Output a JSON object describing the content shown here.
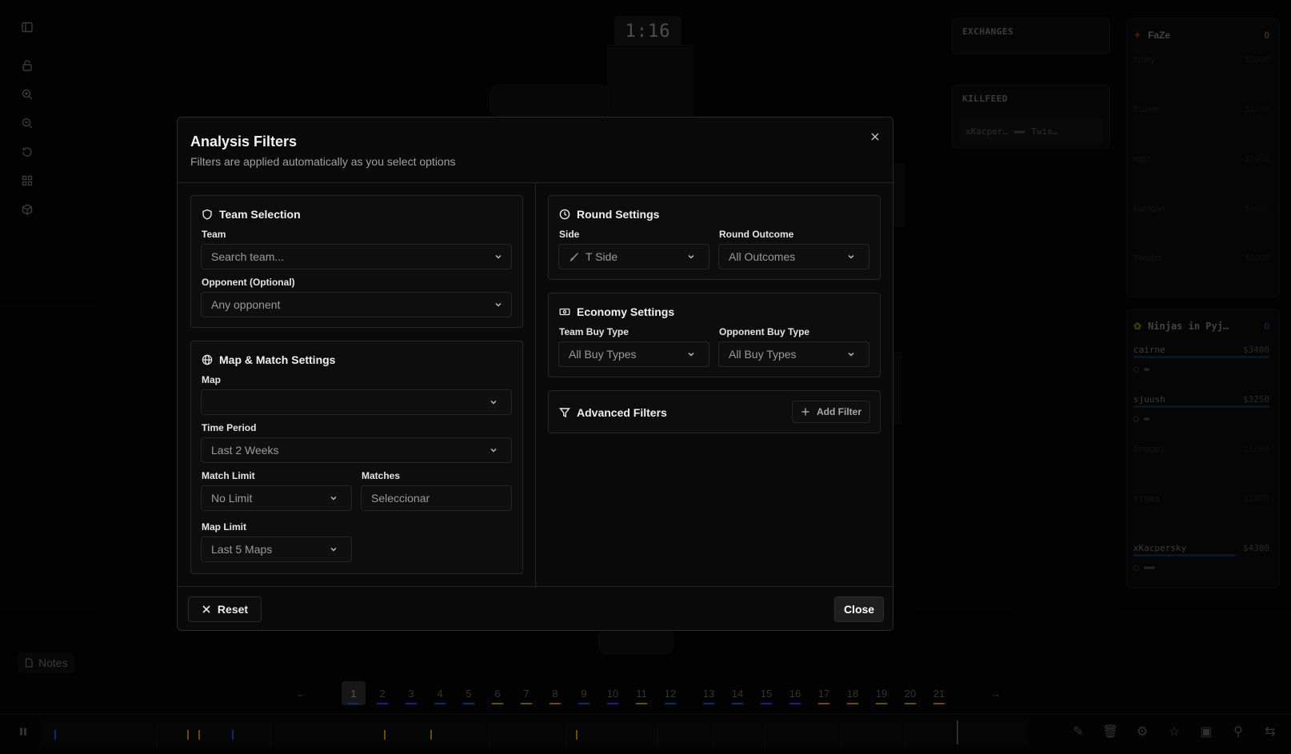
{
  "background": {
    "timer": "1:16",
    "exchanges_title": "EXCHANGES",
    "killfeed_title": "KILLFEED",
    "killfeed_entry": {
      "attacker": "xKacper…",
      "victim": "Twis…"
    },
    "team_a": {
      "name": "FaZe",
      "score": "0",
      "players": [
        {
          "name": "broky",
          "money": "$1000"
        },
        {
          "name": "frozen",
          "money": "$1000"
        },
        {
          "name": "ropz",
          "money": "$1000"
        },
        {
          "name": "karrigan",
          "money": "$1000"
        },
        {
          "name": "Twistzz",
          "money": "$1000"
        }
      ]
    },
    "team_b": {
      "name": "Ninjas in Pyj…",
      "score": "0",
      "players": [
        {
          "name": "cairne",
          "money": "$3400",
          "hp": 100
        },
        {
          "name": "sjuush",
          "money": "$3250",
          "hp": 100
        },
        {
          "name": "Snappi",
          "money": "$1000"
        },
        {
          "name": "xtema",
          "money": "$1000"
        },
        {
          "name": "xKacpersky",
          "money": "$4300",
          "hp": 75
        }
      ]
    },
    "notes_label": "Notes",
    "rounds": [
      "1",
      "2",
      "3",
      "4",
      "5",
      "6",
      "7",
      "8",
      "9",
      "10",
      "11",
      "12",
      "13",
      "14",
      "15",
      "16",
      "17",
      "18",
      "19",
      "20",
      "21"
    ],
    "active_round": "1",
    "colors": {
      "ct": "#1d4ed8",
      "t": "#ca8a04",
      "bg": "#050505"
    }
  },
  "modal": {
    "title": "Analysis Filters",
    "subtitle": "Filters are applied automatically as you select options",
    "team_selection": {
      "title": "Team Selection",
      "team_label": "Team",
      "team_placeholder": "Search team...",
      "opponent_label": "Opponent (Optional)",
      "opponent_placeholder": "Any opponent"
    },
    "map_match": {
      "title": "Map & Match Settings",
      "map_label": "Map",
      "map_value": "",
      "time_period_label": "Time Period",
      "time_period_value": "Last 2 Weeks",
      "match_limit_label": "Match Limit",
      "match_limit_value": "No Limit",
      "matches_label": "Matches",
      "matches_placeholder": "Seleccionar",
      "map_limit_label": "Map Limit",
      "map_limit_value": "Last 5 Maps"
    },
    "round_settings": {
      "title": "Round Settings",
      "side_label": "Side",
      "side_value": "T Side",
      "outcome_label": "Round Outcome",
      "outcome_value": "All Outcomes"
    },
    "economy_settings": {
      "title": "Economy Settings",
      "team_buy_label": "Team Buy Type",
      "team_buy_value": "All Buy Types",
      "opp_buy_label": "Opponent Buy Type",
      "opp_buy_value": "All Buy Types"
    },
    "advanced": {
      "title": "Advanced Filters",
      "add_label": "Add Filter"
    },
    "footer": {
      "reset_label": "Reset",
      "close_label": "Close"
    }
  }
}
